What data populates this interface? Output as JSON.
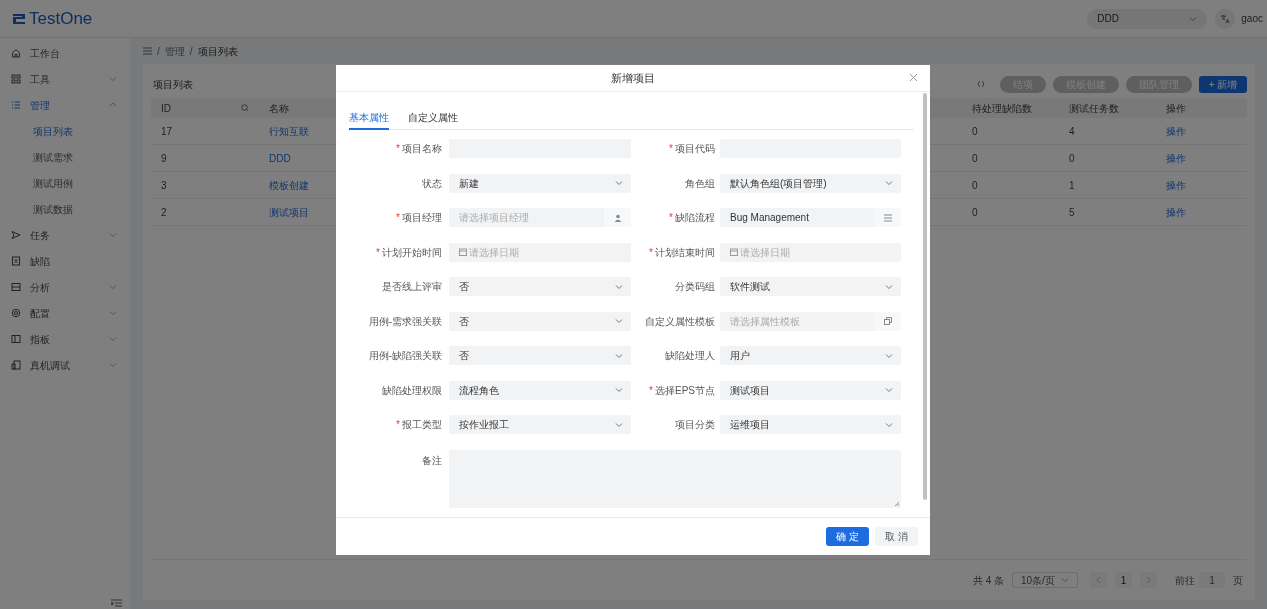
{
  "header": {
    "logo": "TestOne",
    "project_select": "DDD",
    "user": "gaoc"
  },
  "sidebar": {
    "items": [
      {
        "label": "工作台",
        "selected": false
      },
      {
        "label": "工具",
        "selected": false,
        "expanded": false
      },
      {
        "label": "管理",
        "selected": true,
        "expanded": true,
        "children": [
          {
            "label": "项目列表",
            "selected": true
          },
          {
            "label": "测试需求",
            "selected": false
          },
          {
            "label": "测试用例",
            "selected": false
          },
          {
            "label": "测试数据",
            "selected": false
          }
        ]
      },
      {
        "label": "任务",
        "selected": false,
        "expanded": false
      },
      {
        "label": "缺陷",
        "selected": false
      },
      {
        "label": "分析",
        "selected": false,
        "expanded": false
      },
      {
        "label": "配置",
        "selected": false,
        "expanded": false
      },
      {
        "label": "指板",
        "selected": false,
        "expanded": false
      },
      {
        "label": "真机调试",
        "selected": false,
        "expanded": false
      }
    ]
  },
  "breadcrumb": {
    "separator": "/",
    "items": [
      "管理",
      "项目列表"
    ]
  },
  "card": {
    "title": "项目列表",
    "toolbar": [
      {
        "label": "结项",
        "kind": "secondary"
      },
      {
        "label": "模板创建",
        "kind": "secondary"
      },
      {
        "label": "团队管理",
        "kind": "secondary"
      },
      {
        "label": "+ 新增",
        "kind": "primary"
      }
    ],
    "table": {
      "columns": [
        {
          "label": "ID",
          "kind": "text"
        },
        {
          "label": "名称",
          "kind": "link"
        },
        {
          "label": "待处理缺陷数",
          "kind": "text"
        },
        {
          "label": "测试任务数",
          "kind": "text"
        },
        {
          "label": "操作",
          "kind": "link"
        }
      ],
      "rows": [
        [
          "17",
          "行知互联",
          "0",
          "4",
          "操作"
        ],
        [
          "9",
          "DDD",
          "0",
          "0",
          "操作"
        ],
        [
          "3",
          "模板创建",
          "0",
          "1",
          "操作"
        ],
        [
          "2",
          "测试项目",
          "0",
          "5",
          "操作"
        ]
      ]
    },
    "pagination": {
      "total": "共 4 条",
      "page_size": "10条/页",
      "current": "1",
      "goto_label": "前往",
      "goto_value": "1",
      "page_unit": "页"
    }
  },
  "modal": {
    "title": "新增项目",
    "required_mark": "*",
    "tabs": [
      {
        "label": "基本属性",
        "selected": true
      },
      {
        "label": "自定义属性",
        "selected": false
      }
    ],
    "fields": [
      {
        "label": "项目名称",
        "required": true,
        "kind": "input"
      },
      {
        "label": "项目代码",
        "required": true,
        "kind": "input"
      },
      {
        "label": "状态",
        "required": false,
        "kind": "select",
        "value": "新建"
      },
      {
        "label": "角色组",
        "required": false,
        "kind": "select",
        "value": "默认角色组(项目管理)"
      },
      {
        "label": "项目经理",
        "required": true,
        "kind": "person",
        "placeholder": "请选择项目经理"
      },
      {
        "label": "缺陷流程",
        "required": true,
        "kind": "flow",
        "value": "Bug Management"
      },
      {
        "label": "计划开始时间",
        "required": true,
        "kind": "date",
        "placeholder": "请选择日期"
      },
      {
        "label": "计划结束时间",
        "required": true,
        "kind": "date",
        "placeholder": "请选择日期"
      },
      {
        "label": "是否线上评审",
        "required": false,
        "kind": "select",
        "value": "否"
      },
      {
        "label": "分类码组",
        "required": false,
        "kind": "select",
        "value": "软件测试"
      },
      {
        "label": "用例-需求强关联",
        "required": false,
        "kind": "select",
        "value": "否"
      },
      {
        "label": "自定义属性模板",
        "required": false,
        "kind": "template",
        "placeholder": "请选择属性模板"
      },
      {
        "label": "用例-缺陷强关联",
        "required": false,
        "kind": "select",
        "value": "否"
      },
      {
        "label": "缺陷处理人",
        "required": false,
        "kind": "select",
        "value": "用户"
      },
      {
        "label": "缺陷处理权限",
        "required": false,
        "kind": "select",
        "value": "流程角色"
      },
      {
        "label": "选择EPS节点",
        "required": true,
        "kind": "select",
        "value": "测试项目"
      },
      {
        "label": "报工类型",
        "required": true,
        "kind": "select",
        "value": "按作业报工"
      },
      {
        "label": "项目分类",
        "required": false,
        "kind": "select",
        "value": "运维项目"
      },
      {
        "label": "备注",
        "required": false,
        "kind": "textarea"
      }
    ],
    "buttons": [
      {
        "label": "确 定",
        "kind": "primary"
      },
      {
        "label": "取 消",
        "kind": "secondary"
      }
    ]
  }
}
